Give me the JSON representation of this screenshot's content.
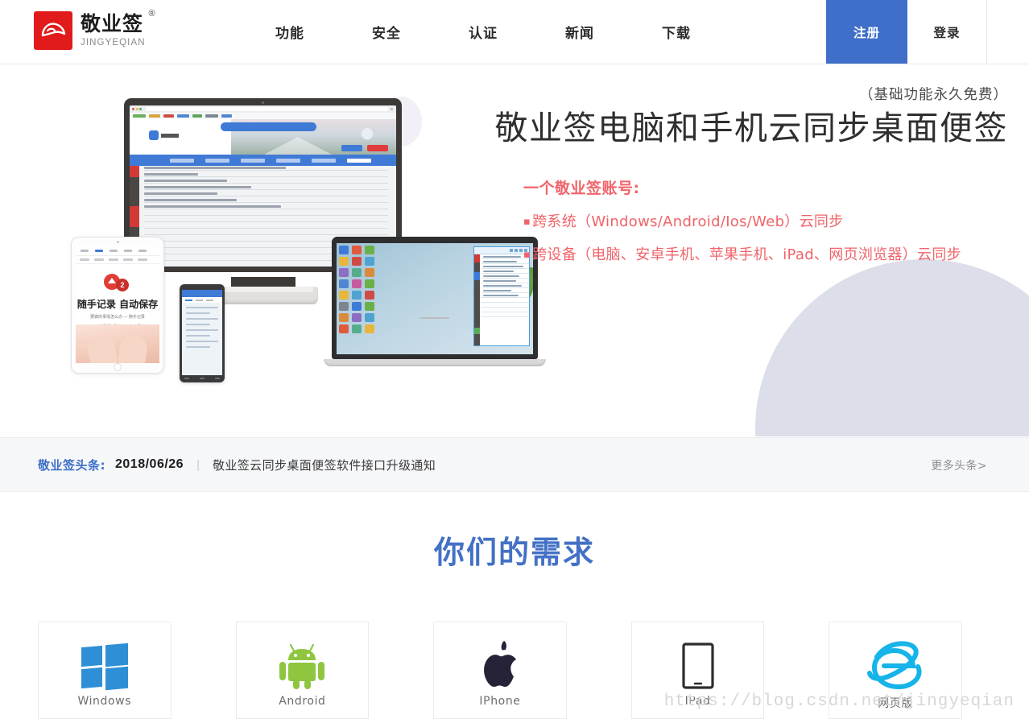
{
  "header": {
    "logo": {
      "icon": "jingyeqian-bird-logo-icon",
      "cn_name": "敬业签",
      "registered_mark": "®",
      "en_name": "JINGYEQIAN",
      "mark_color": "#e11b1b"
    },
    "nav": [
      {
        "label": "功能",
        "name": "nav-item-features"
      },
      {
        "label": "安全",
        "name": "nav-item-security"
      },
      {
        "label": "认证",
        "name": "nav-item-certification"
      },
      {
        "label": "新闻",
        "name": "nav-item-news"
      },
      {
        "label": "下载",
        "name": "nav-item-download"
      }
    ],
    "register_label": "注册",
    "login_label": "登录",
    "register_bg": "#3f6fc9"
  },
  "hero": {
    "free_note": "（基础功能永久免费）",
    "title": "敬业签电脑和手机云同步桌面便签",
    "sub_lead": "一个敬业签账号:",
    "bullets": [
      "跨系统（Windows/Android/Ios/Web）云同步",
      "跨设备（电脑、安卓手机、苹果手机、iPad、网页浏览器）云同步"
    ],
    "bullet_marker": "▪",
    "accent_color": "#f0646a",
    "tablet_headline": "随手记录 自动保存",
    "tablet_sub_1": "要做的事情怎么办 — 随手记录",
    "tablet_sub_2": "记下的事情不确认 — 自动保存",
    "tablet_badge_count": "2"
  },
  "newsbar": {
    "tag": "敬业签头条:",
    "date": "2018/06/26",
    "separator": "|",
    "title": "敬业签云同步桌面便签软件接口升级通知",
    "more_label": "更多头条>",
    "tag_color": "#3f6fc9"
  },
  "needs": {
    "section_title": "你们的需求",
    "title_color": "#4371c5",
    "cards": [
      {
        "label": "Windows",
        "icon": "windows-logo-icon",
        "name": "platform-card-windows"
      },
      {
        "label": "Android",
        "icon": "android-logo-icon",
        "name": "platform-card-android"
      },
      {
        "label": "IPhone",
        "icon": "apple-logo-icon",
        "name": "platform-card-iphone"
      },
      {
        "label": "IPad",
        "icon": "ipad-tablet-icon",
        "name": "platform-card-ipad"
      },
      {
        "label": "网页版",
        "icon": "internet-explorer-logo-icon",
        "name": "platform-card-web"
      }
    ]
  },
  "watermark": {
    "text": "https://blog.csdn.net/jingyeqian"
  }
}
